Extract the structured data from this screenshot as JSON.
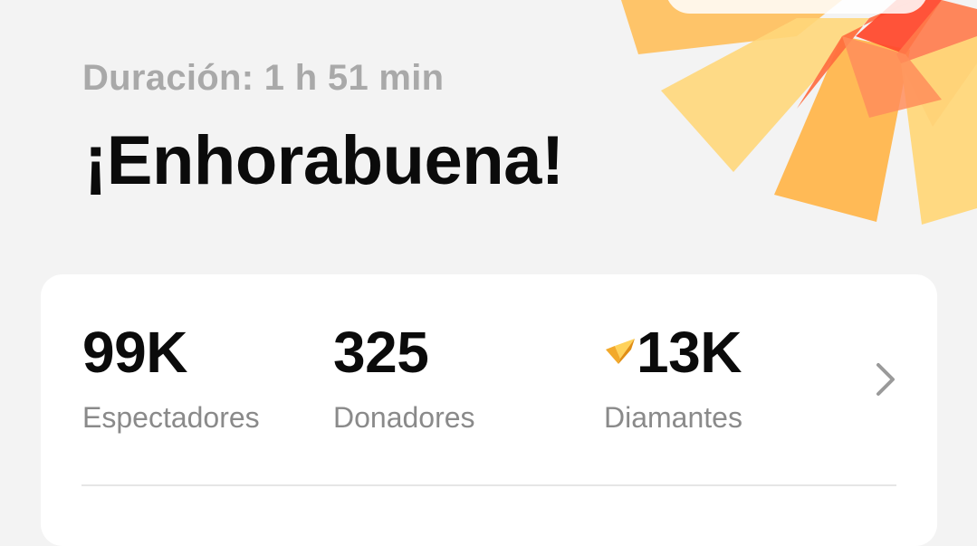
{
  "header": {
    "duration_text": "Duración: 1 h 51 min",
    "title": "¡Enhorabuena!"
  },
  "stats": [
    {
      "value": "99K",
      "label": "Espectadores"
    },
    {
      "value": "325",
      "label": "Donadores"
    },
    {
      "value": "13K",
      "label": "Diamantes",
      "icon": "diamond-icon"
    }
  ],
  "colors": {
    "background": "#f3f3f3",
    "card": "#ffffff",
    "burst_red": "#ff4a2e",
    "burst_orange": "#ffb64d",
    "burst_yellow": "#ffdc84"
  }
}
